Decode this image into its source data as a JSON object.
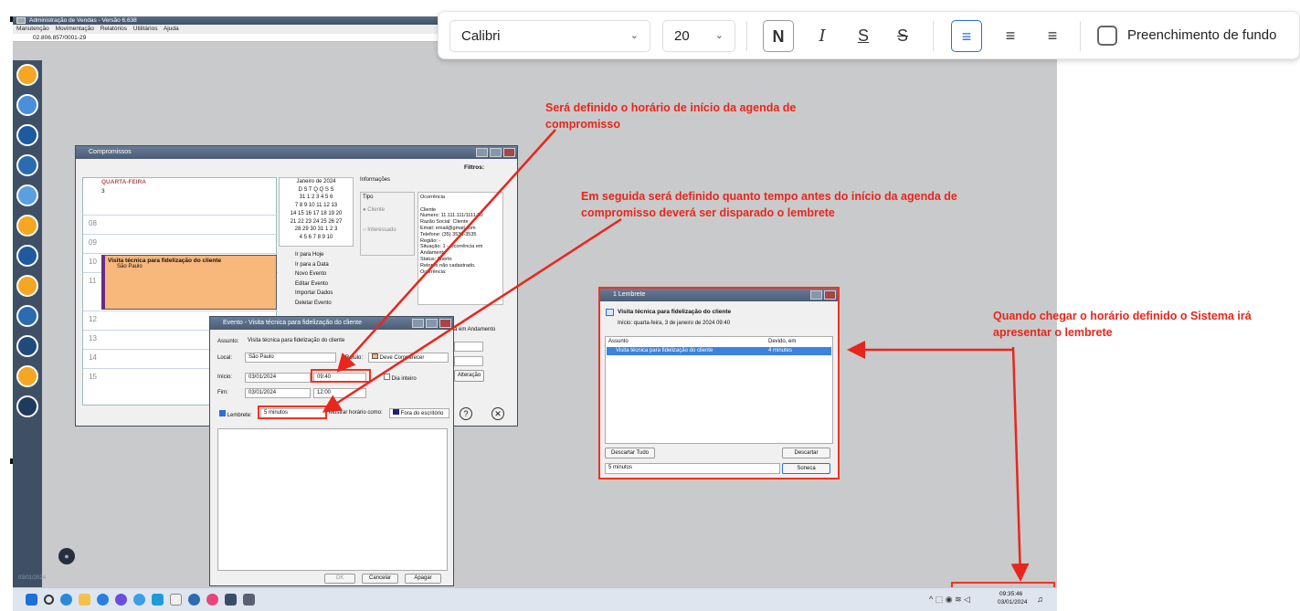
{
  "app": {
    "title": "Administração de Vendas - Versão 6.638",
    "menu": [
      "Manutenção",
      "Movimentação",
      "Relatórios",
      "Utilitários",
      "Ajuda"
    ],
    "cnpj": "02.806.857/0001-29",
    "sidebar_date": "03/01/2024"
  },
  "toolbar": {
    "font": "Calibri",
    "size": "20",
    "bold": "N",
    "italic": "I",
    "underline": "S",
    "strike": "S",
    "fill_label": "Preenchimento de fundo"
  },
  "annotations": {
    "a1": "Será definido o horário de início da agenda de compromisso",
    "a2": "Em seguida será definido quanto tempo antes do início da agenda de compromisso deverá ser disparado o lembrete",
    "a3": "Quando chegar o horário definido o Sistema irá apresentar o lembrete"
  },
  "compromissos": {
    "title": "Compromissos",
    "filtros": "Filtros:",
    "day": "QUARTA-FEIRA",
    "daynum": "3",
    "hours": [
      "08",
      "09",
      "10",
      "11",
      "12",
      "13",
      "14",
      "15"
    ],
    "event_title": "Visita técnica para fidelização do cliente",
    "event_loc": "São Paulo",
    "month": "Janeiro de 2024",
    "weekdays": "D S T Q Q S S",
    "weeks": [
      "31 1 2 3 4 5 6",
      "7 8 9 10 11 12 13",
      "14 15 16 17 18 19 20",
      "21 22 23 24 25 26 27",
      "28 29 30 31 1 2 3",
      "4 5 6 7 8 9 10"
    ],
    "actions": [
      "Ir para Hoje",
      "Ir para a Data",
      "Novo Evento",
      "Editar Evento",
      "Importar Dados",
      "Deletar Evento"
    ],
    "info_label": "Informações",
    "tipo": "Tipo",
    "opt1": "Cliente",
    "opt2": "Interessado",
    "info_lines": [
      "Ocorrência",
      "",
      "Cliente",
      "Numero: 11.111.111/1111-80",
      "Razão Social: Cliente",
      "Email: email@gmail.com",
      "Telefone: (35) 3535-3535",
      "Região: -",
      "Situação: 1 - Ocorrência em",
      "Andamento",
      "Status: Aberto",
      "Retorno não cadastrado.",
      "Ocorrência:"
    ]
  },
  "evento": {
    "title": "Evento - Visita técnica para fidelização do cliente",
    "assunto_label": "Assunto:",
    "assunto": "Visita técnica para fidelização do cliente",
    "local_label": "Local:",
    "local": "São Paulo",
    "rotulo_label": "Rótulo:",
    "rotulo": "Deve Comparecer",
    "inicio_label": "Início:",
    "inicio_data": "03/01/2024",
    "inicio_hora": "09:40",
    "dia_inteiro": "Dia inteiro",
    "fim_label": "Fim:",
    "fim_data": "03/01/2024",
    "fim_hora": "12:00",
    "lembrete_label": "Lembrete:",
    "lembrete": "5 minutos",
    "mostrar_label": "Mostrar horário como:",
    "mostrar": "Fora do escritório",
    "ok": "OK",
    "cancelar": "Cancelar",
    "apagar": "Apagar",
    "side1": "a em Andamento",
    "side2": "Alteração"
  },
  "lembrete": {
    "title": "1 Lembrete",
    "header": "Visita técnica para fidelização do cliente",
    "inicio": "Início: quarta-feira, 3 de janeiro de 2024 09:40",
    "col1": "Assunto",
    "col2": "Devido, em",
    "row_subject": "Visita técnica para fidelização do cliente",
    "row_due": "4 minutes",
    "descartar_tudo": "Descartar Tudo",
    "descartar": "Descartar",
    "snooze": "5 minutos",
    "soneca": "Soneca"
  },
  "taskbar": {
    "time": "09:35:46",
    "date": "03/01/2024"
  }
}
